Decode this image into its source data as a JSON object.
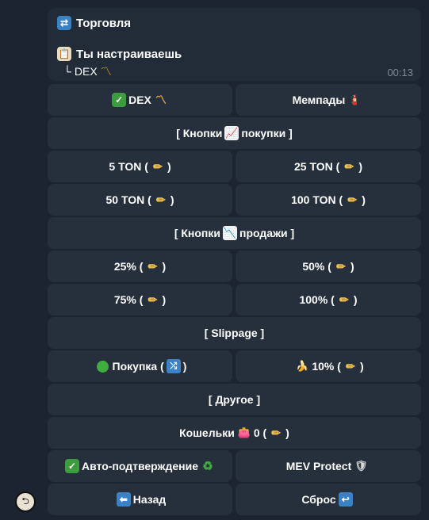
{
  "message": {
    "header_icon": "repeat-icon",
    "title": "Торговля",
    "setup_icon": "clipboard-icon",
    "setup_text": "Ты настраиваешь",
    "tree_prefix": "└",
    "sub_item": "DEX",
    "sub_icon": "dex-zigzag-icon",
    "time": "00:13"
  },
  "buttons": {
    "dex": "DEX",
    "mempads": "Мемпады",
    "buy_header_left": "[ Кнопки",
    "buy_header_right": "покупки ]",
    "ton5": "5 TON",
    "ton25": "25 TON",
    "ton50": "50 TON",
    "ton100": "100 TON",
    "sell_header_left": "[ Кнопки",
    "sell_header_right": "продажи ]",
    "p25": "25%",
    "p50": "50%",
    "p75": "75%",
    "p100": "100%",
    "slippage": "[ Slippage ]",
    "buy_slip": "Покупка",
    "sell_slip": "10%",
    "other": "[ Другое ]",
    "wallets": "Кошельки",
    "wallets_count": "0",
    "auto_confirm": "Авто-подтверждение",
    "mev": "MEV Protect",
    "back": "Назад",
    "reset": "Сброс"
  },
  "colors": {
    "background": "#1b2430",
    "button": "#26303c",
    "message": "#222c39",
    "check_green": "#3c9d3f",
    "time_gray": "#7f8a99"
  }
}
